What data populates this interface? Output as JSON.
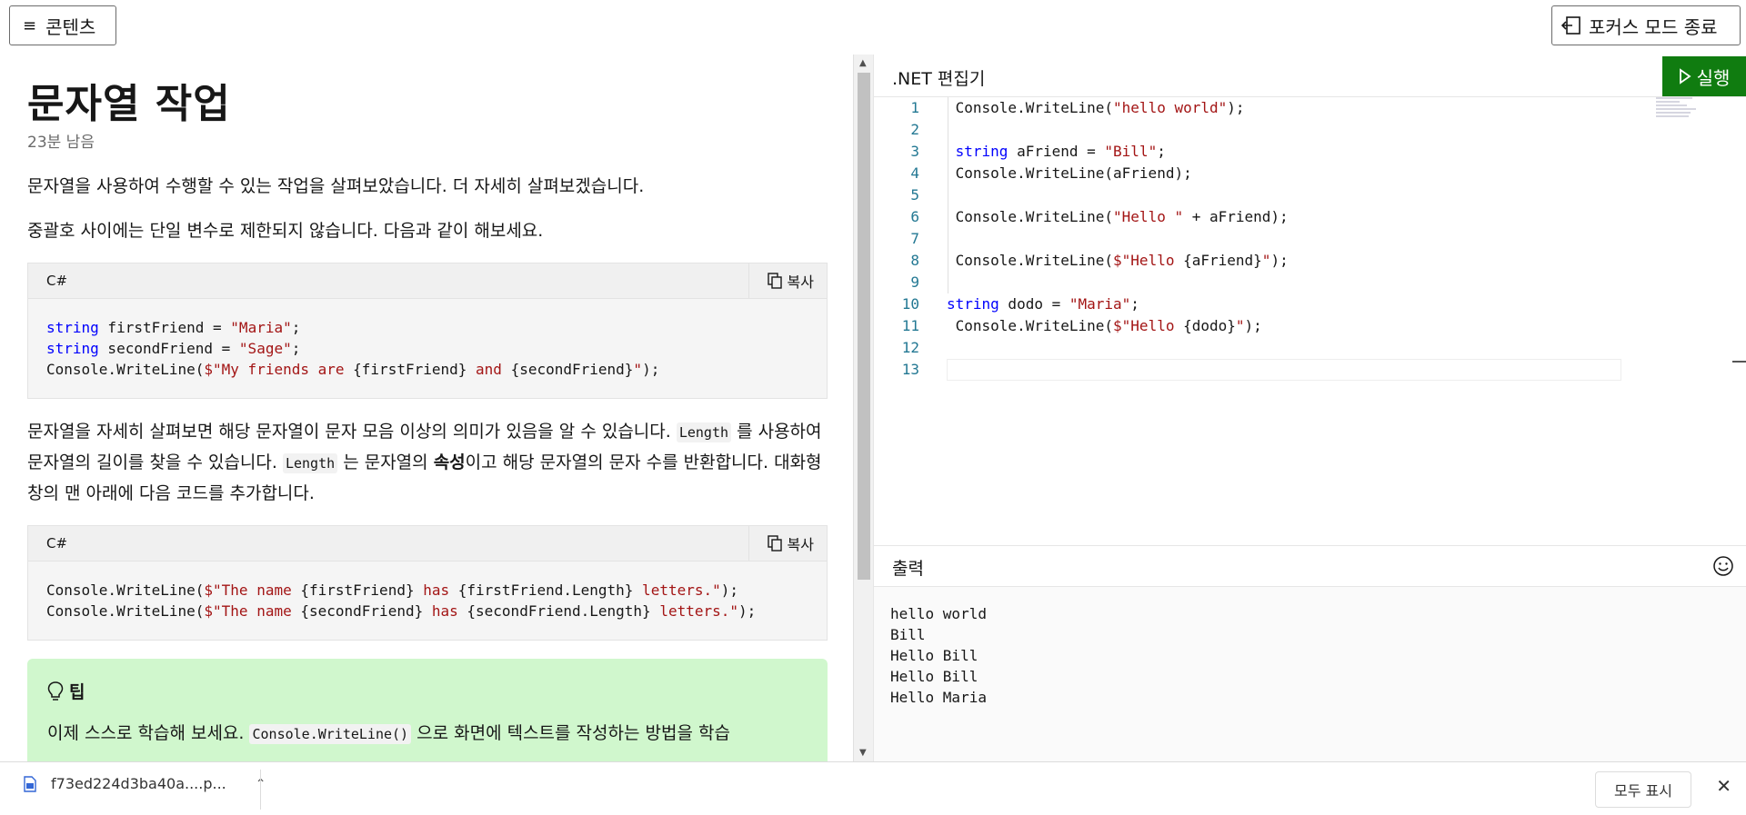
{
  "topbar": {
    "contents_label": "콘텐츠",
    "focus_exit_label": "포커스 모드 종료"
  },
  "article": {
    "title": "문자열 작업",
    "time_remaining": "23분 남음",
    "para1": "문자열을 사용하여 수행할 수 있는 작업을 살펴보았습니다. 더 자세히 살펴보겠습니다.",
    "para2": "중괄호 사이에는 단일 변수로 제한되지 않습니다. 다음과 같이 해보세요.",
    "code1": {
      "lang": "C#",
      "copy_label": "복사",
      "l1_kw": "string",
      "l1_rest": " firstFriend = ",
      "l1_str": "\"Maria\"",
      "l1_end": ";",
      "l2_kw": "string",
      "l2_rest": " secondFriend = ",
      "l2_str": "\"Sage\"",
      "l2_end": ";",
      "l3_a": "Console.WriteLine(",
      "l3_s1": "$\"My friends are ",
      "l3_b": "{firstFriend}",
      "l3_s2": " and ",
      "l3_c": "{secondFriend}",
      "l3_s3": "\"",
      "l3_end": ");"
    },
    "para3_a": "문자열을 자세히 살펴보면 해당 문자열이 문자 모음 이상의 의미가 있음을 알 수 있습니다. ",
    "para3_code1": "Length",
    "para3_b": " 를 사용하여 문자열의 길이를 찾을 수 있습니다. ",
    "para3_code2": "Length",
    "para3_c": " 는 문자열의 ",
    "para3_bold": "속성",
    "para3_d": "이고 해당 문자열의 문자 수를 반환합니다. 대화형 창의 맨 아래에 다음 코드를 추가합니다.",
    "code2": {
      "lang": "C#",
      "copy_label": "복사",
      "l1_a": "Console.WriteLine(",
      "l1_s1": "$\"The name ",
      "l1_b": "{firstFriend}",
      "l1_s2": " has ",
      "l1_c": "{firstFriend.Length}",
      "l1_s3": " letters.\"",
      "l1_end": ");",
      "l2_a": "Console.WriteLine(",
      "l2_s1": "$\"The name ",
      "l2_b": "{secondFriend}",
      "l2_s2": " has ",
      "l2_c": "{secondFriend.Length}",
      "l2_s3": " letters.\"",
      "l2_end": ");"
    },
    "tip": {
      "title": "팁",
      "text_a": "이제 스스로 학습해 보세요. ",
      "text_code": "Console.WriteLine()",
      "text_b": " 으로 화면에 텍스트를 작성하는 방법을 학습"
    }
  },
  "editor": {
    "title": ".NET 편집기",
    "run_label": "실행",
    "line_numbers": [
      "1",
      "2",
      "3",
      "4",
      "5",
      "6",
      "7",
      "8",
      "9",
      "10",
      "11",
      "12",
      "13"
    ]
  },
  "output": {
    "title": "출력",
    "lines": [
      "hello world",
      "Bill",
      "Hello Bill",
      "Hello Bill",
      "Hello Maria"
    ]
  },
  "download_bar": {
    "filename": "f73ed224d3ba40a....p...",
    "show_all_label": "모두 표시"
  }
}
